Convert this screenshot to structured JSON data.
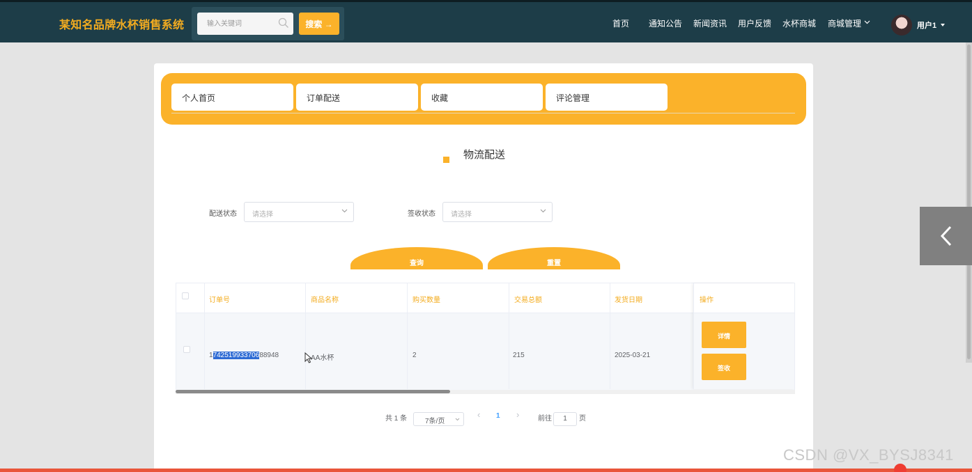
{
  "app": {
    "title": "某知名品牌水杯销售系统"
  },
  "search": {
    "placeholder": "输入关键词",
    "button_label": "搜索 →"
  },
  "nav": {
    "items": [
      "首页",
      "通知公告",
      "新闻资讯",
      "用户反馈",
      "水杯商城",
      "商城管理"
    ]
  },
  "user": {
    "name": "用户1"
  },
  "tabs": [
    "个人首页",
    "订单配送",
    "收藏",
    "评论管理"
  ],
  "section": {
    "title": "物流配送"
  },
  "filters": {
    "status_label": "配送状态",
    "status_placeholder": "请选择",
    "sign_label": "签收状态",
    "sign_placeholder": "请选择"
  },
  "buttons": {
    "query": "查询",
    "reset": "重置"
  },
  "table": {
    "columns": [
      "订单号",
      "商品名称",
      "购买数量",
      "交易总额",
      "发货日期",
      "操作"
    ],
    "rows": [
      {
        "order_no_pre": "1",
        "order_no_sel": "742519933706",
        "order_no_post": "88948",
        "product": "AA水杯",
        "qty": "2",
        "total": "215",
        "ship_date": "2025-03-21",
        "detail_btn": "详情",
        "sign_btn": "签收"
      }
    ]
  },
  "pagination": {
    "total_text": "共 1 条",
    "page_size": "7条/页",
    "current_page": "1",
    "goto_label": "前往",
    "goto_value": "1",
    "page_unit": "页",
    "prev_icon": "‹",
    "next_icon": "›"
  },
  "watermark": "CSDN @VX_BYSJ8341",
  "colors": {
    "accent": "#fbb22a",
    "topbar": "#1d3d48",
    "title": "#f3ac20"
  }
}
